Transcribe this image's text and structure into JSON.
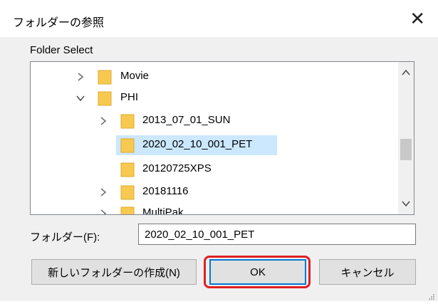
{
  "dialog": {
    "title": "フォルダーの参照",
    "instruction": "Folder Select"
  },
  "tree": {
    "items": [
      {
        "label": "Movie",
        "expander": "collapsed"
      },
      {
        "label": "PHI",
        "expander": "expanded"
      },
      {
        "label": "2013_07_01_SUN",
        "expander": "collapsed"
      },
      {
        "label": "2020_02_10_001_PET",
        "expander": "none",
        "selected": true
      },
      {
        "label": "20120725XPS",
        "expander": "none"
      },
      {
        "label": "20181116",
        "expander": "collapsed"
      },
      {
        "label": "MultiPak",
        "expander": "collapsed"
      }
    ]
  },
  "folder_field": {
    "label": "フォルダー(F):",
    "value": "2020_02_10_001_PET"
  },
  "buttons": {
    "new_folder": "新しいフォルダーの作成(N)",
    "ok": "OK",
    "cancel": "キャンセル"
  },
  "colors": {
    "folder": "#f7c951",
    "selection": "#cce8ff",
    "highlight": "#e02020",
    "default_button_border": "#0078d7"
  },
  "icons": {
    "close": "close-icon",
    "folder": "folder-icon",
    "expand": "chevron-right-icon",
    "collapse": "chevron-down-icon",
    "scroll_up": "scroll-up-arrow-icon",
    "scroll_down": "scroll-down-arrow-icon"
  }
}
